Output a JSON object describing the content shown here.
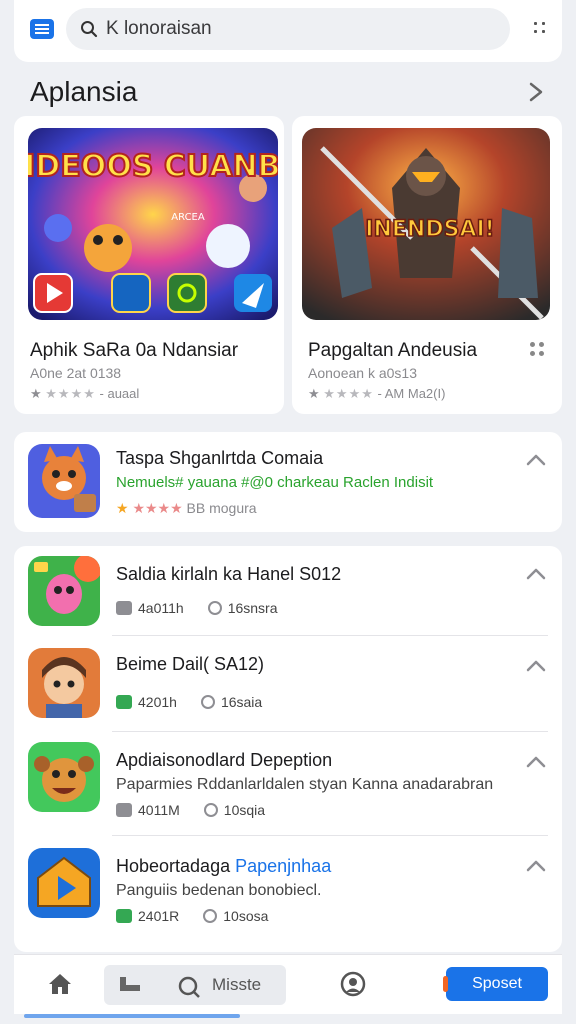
{
  "search": {
    "value": "K lonoraisan"
  },
  "featured": {
    "title": "Aplansia",
    "cards": [
      {
        "art_text": "PIDEOOS CUANBA",
        "art_sub": "ARCEA",
        "title": "Aphik SaRa 0a Ndansiar",
        "subtitle": "A0ne 2at 0138",
        "rating_text": "- auaal"
      },
      {
        "art_text": "INENDSAI!",
        "title": "Papgaltan Andeusia",
        "subtitle": "Aonoean k a0s13",
        "rating_text": "- AM Ma2(I)"
      }
    ]
  },
  "promoted": {
    "title": "Taspa Shganlrtda Comaia",
    "green_text": "Nemuels# yauana  #@0  charkeau Raclen Indisit",
    "rating_text": "BB mogura"
  },
  "list": [
    {
      "title": "Saldia kirlaln ka Hanel S012",
      "meta1": "4a011h",
      "meta2": "16snsra",
      "green": false
    },
    {
      "title": "Beime Dail( SA12)",
      "meta1": "4201h",
      "meta2": "16saia",
      "green": true
    },
    {
      "title": "Apdiaisonodlard Depeption",
      "desc": "Paparmies Rddanlarldalen styan Kanna anadarabran",
      "meta1": "4011M",
      "meta2": "10sqia",
      "green": false
    },
    {
      "title": "Hobeortadaga",
      "title_blue": "Papenjnhaa",
      "desc": "Panguiis bedenan bonobiecl.",
      "meta1": "2401R",
      "meta2": "10sosa",
      "green": true
    }
  ],
  "bottom_nav": {
    "segment_label": "Misste",
    "cta_label": "Sposet"
  },
  "colors": {
    "accent": "#1a73e8",
    "green": "#2aa32e",
    "star": "#f5a623"
  }
}
